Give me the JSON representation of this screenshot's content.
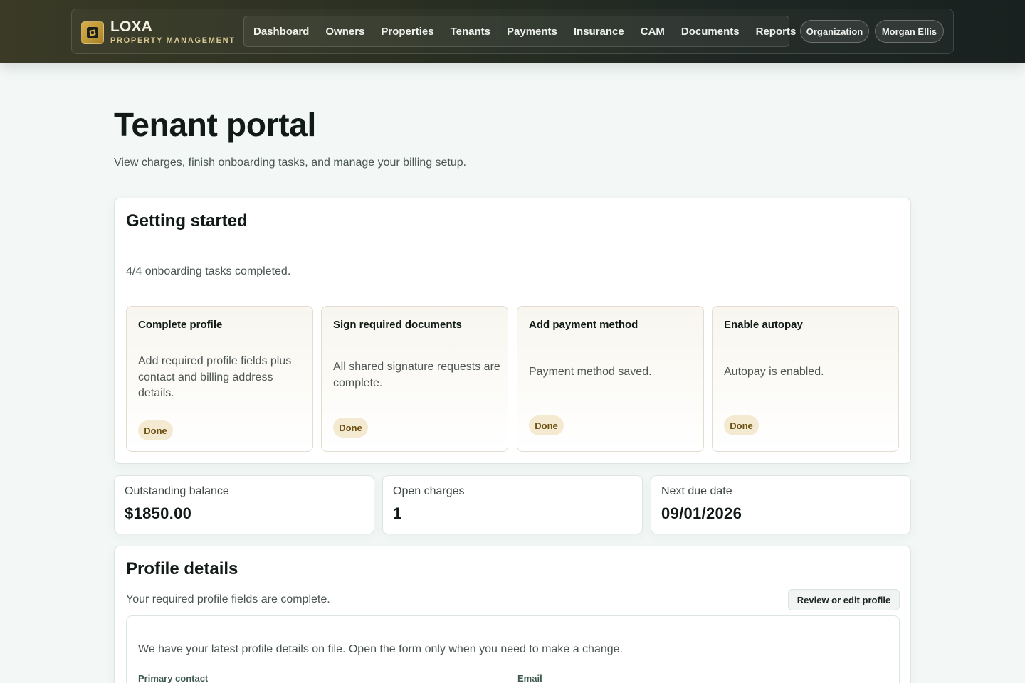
{
  "brand": {
    "name": "LOXA",
    "subtitle": "PROPERTY MANAGEMENT",
    "logo_icon": "loxa-logo-icon"
  },
  "nav": {
    "items": [
      "Dashboard",
      "Owners",
      "Properties",
      "Tenants",
      "Payments",
      "Insurance",
      "CAM",
      "Documents",
      "Reports"
    ]
  },
  "header": {
    "organization_label": "Organization",
    "user_name": "Morgan Ellis"
  },
  "page": {
    "title": "Tenant portal",
    "subtitle": "View charges, finish onboarding tasks, and manage your billing setup."
  },
  "getting_started": {
    "title": "Getting started",
    "progress": "4/4 onboarding tasks completed.",
    "tasks": [
      {
        "title": "Complete profile",
        "description": "Add required profile fields plus contact and billing address details.",
        "status": "Done"
      },
      {
        "title": "Sign required documents",
        "description": "All shared signature requests are complete.",
        "status": "Done"
      },
      {
        "title": "Add payment method",
        "description": "Payment method saved.",
        "status": "Done"
      },
      {
        "title": "Enable autopay",
        "description": "Autopay is enabled.",
        "status": "Done"
      }
    ]
  },
  "stats": [
    {
      "label": "Outstanding balance",
      "value": "$1850.00"
    },
    {
      "label": "Open charges",
      "value": "1"
    },
    {
      "label": "Next due date",
      "value": "09/01/2026"
    }
  ],
  "profile": {
    "title": "Profile details",
    "status": "Your required profile fields are complete.",
    "edit_button": "Review or edit profile",
    "note": "We have your latest profile details on file. Open the form only when you need to make a change.",
    "fields": [
      "Primary contact",
      "Email"
    ]
  },
  "colors": {
    "accent_gold": "#c9a23e",
    "badge_bg": "#f4ead2",
    "badge_text": "#6e5214",
    "header_dark": "#1e2723"
  }
}
